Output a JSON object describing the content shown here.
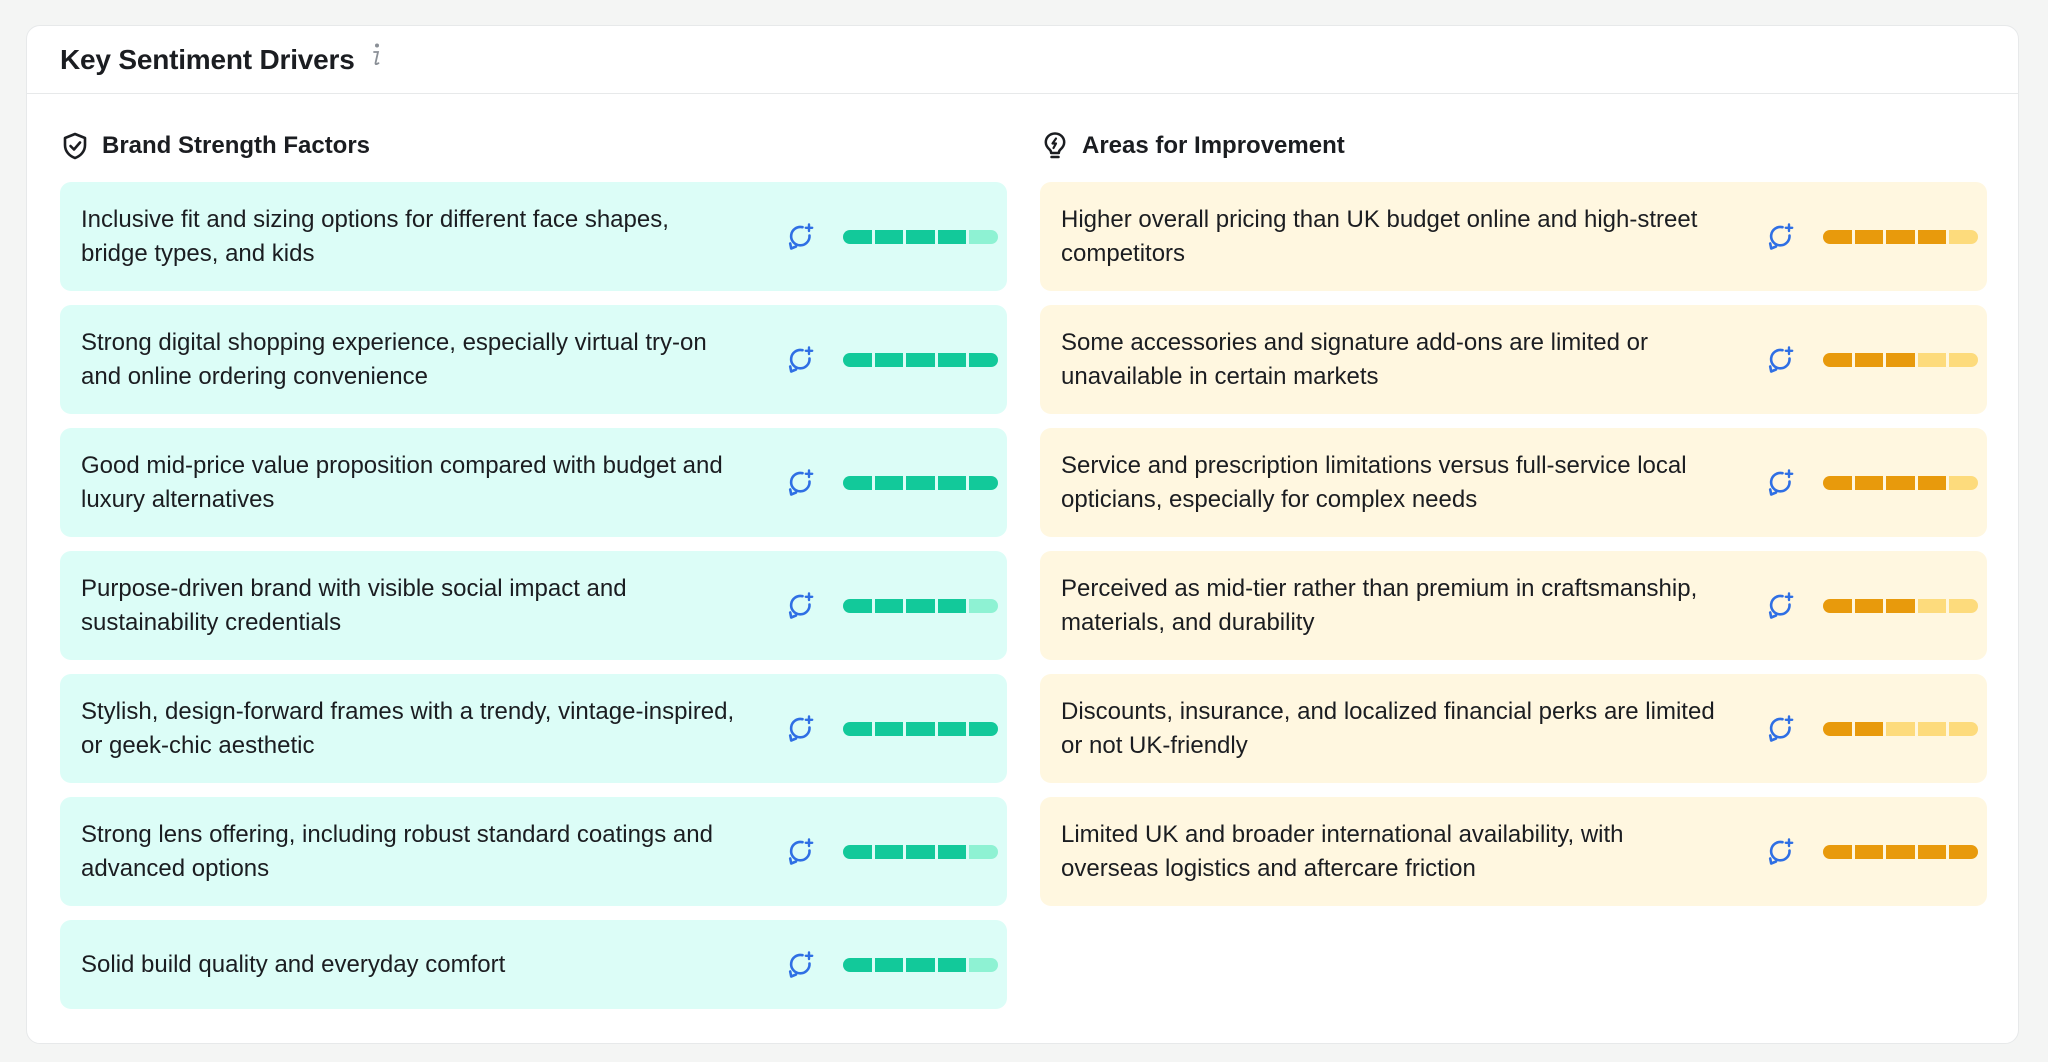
{
  "header": {
    "title": "Key Sentiment Drivers",
    "info_icon": "info-icon"
  },
  "colors": {
    "positive_filled": "#12c99a",
    "positive_empty": "#8ef2d3",
    "negative_filled": "#e89a0c",
    "negative_empty": "#fddb7c",
    "refresh_icon": "#2f6fe4"
  },
  "strengths": {
    "title": "Brand Strength Factors",
    "icon": "shield-check-icon",
    "items": [
      {
        "text": "Inclusive fit and sizing options for different face shapes, bridge types, and kids",
        "score": 4,
        "max": 5
      },
      {
        "text": "Strong digital shopping experience, especially virtual try-on and online ordering convenience",
        "score": 5,
        "max": 5
      },
      {
        "text": "Good mid-price value proposition compared with budget and luxury alternatives",
        "score": 5,
        "max": 5
      },
      {
        "text": "Purpose-driven brand with visible social impact and sustainability credentials",
        "score": 4,
        "max": 5
      },
      {
        "text": "Stylish, design-forward frames with a trendy, vintage-inspired, or geek-chic aesthetic",
        "score": 5,
        "max": 5
      },
      {
        "text": "Strong lens offering, including robust standard coatings and advanced options",
        "score": 4,
        "max": 5
      },
      {
        "text": "Solid build quality and everyday comfort",
        "score": 4,
        "max": 5
      }
    ]
  },
  "improvements": {
    "title": "Areas for Improvement",
    "icon": "lightbulb-icon",
    "items": [
      {
        "text": "Higher overall pricing than UK budget online and high-street competitors",
        "score": 4,
        "max": 5
      },
      {
        "text": "Some accessories and signature add-ons are limited or unavailable in certain markets",
        "score": 3,
        "max": 5
      },
      {
        "text": "Service and prescription limitations versus full-service local opticians, especially for complex needs",
        "score": 4,
        "max": 5
      },
      {
        "text": "Perceived as mid-tier rather than premium in craftsmanship, materials, and durability",
        "score": 3,
        "max": 5
      },
      {
        "text": "Discounts, insurance, and localized financial perks are limited or not UK-friendly",
        "score": 2,
        "max": 5
      },
      {
        "text": "Limited UK and broader international availability, with overseas logistics and aftercare friction",
        "score": 5,
        "max": 5
      }
    ]
  }
}
